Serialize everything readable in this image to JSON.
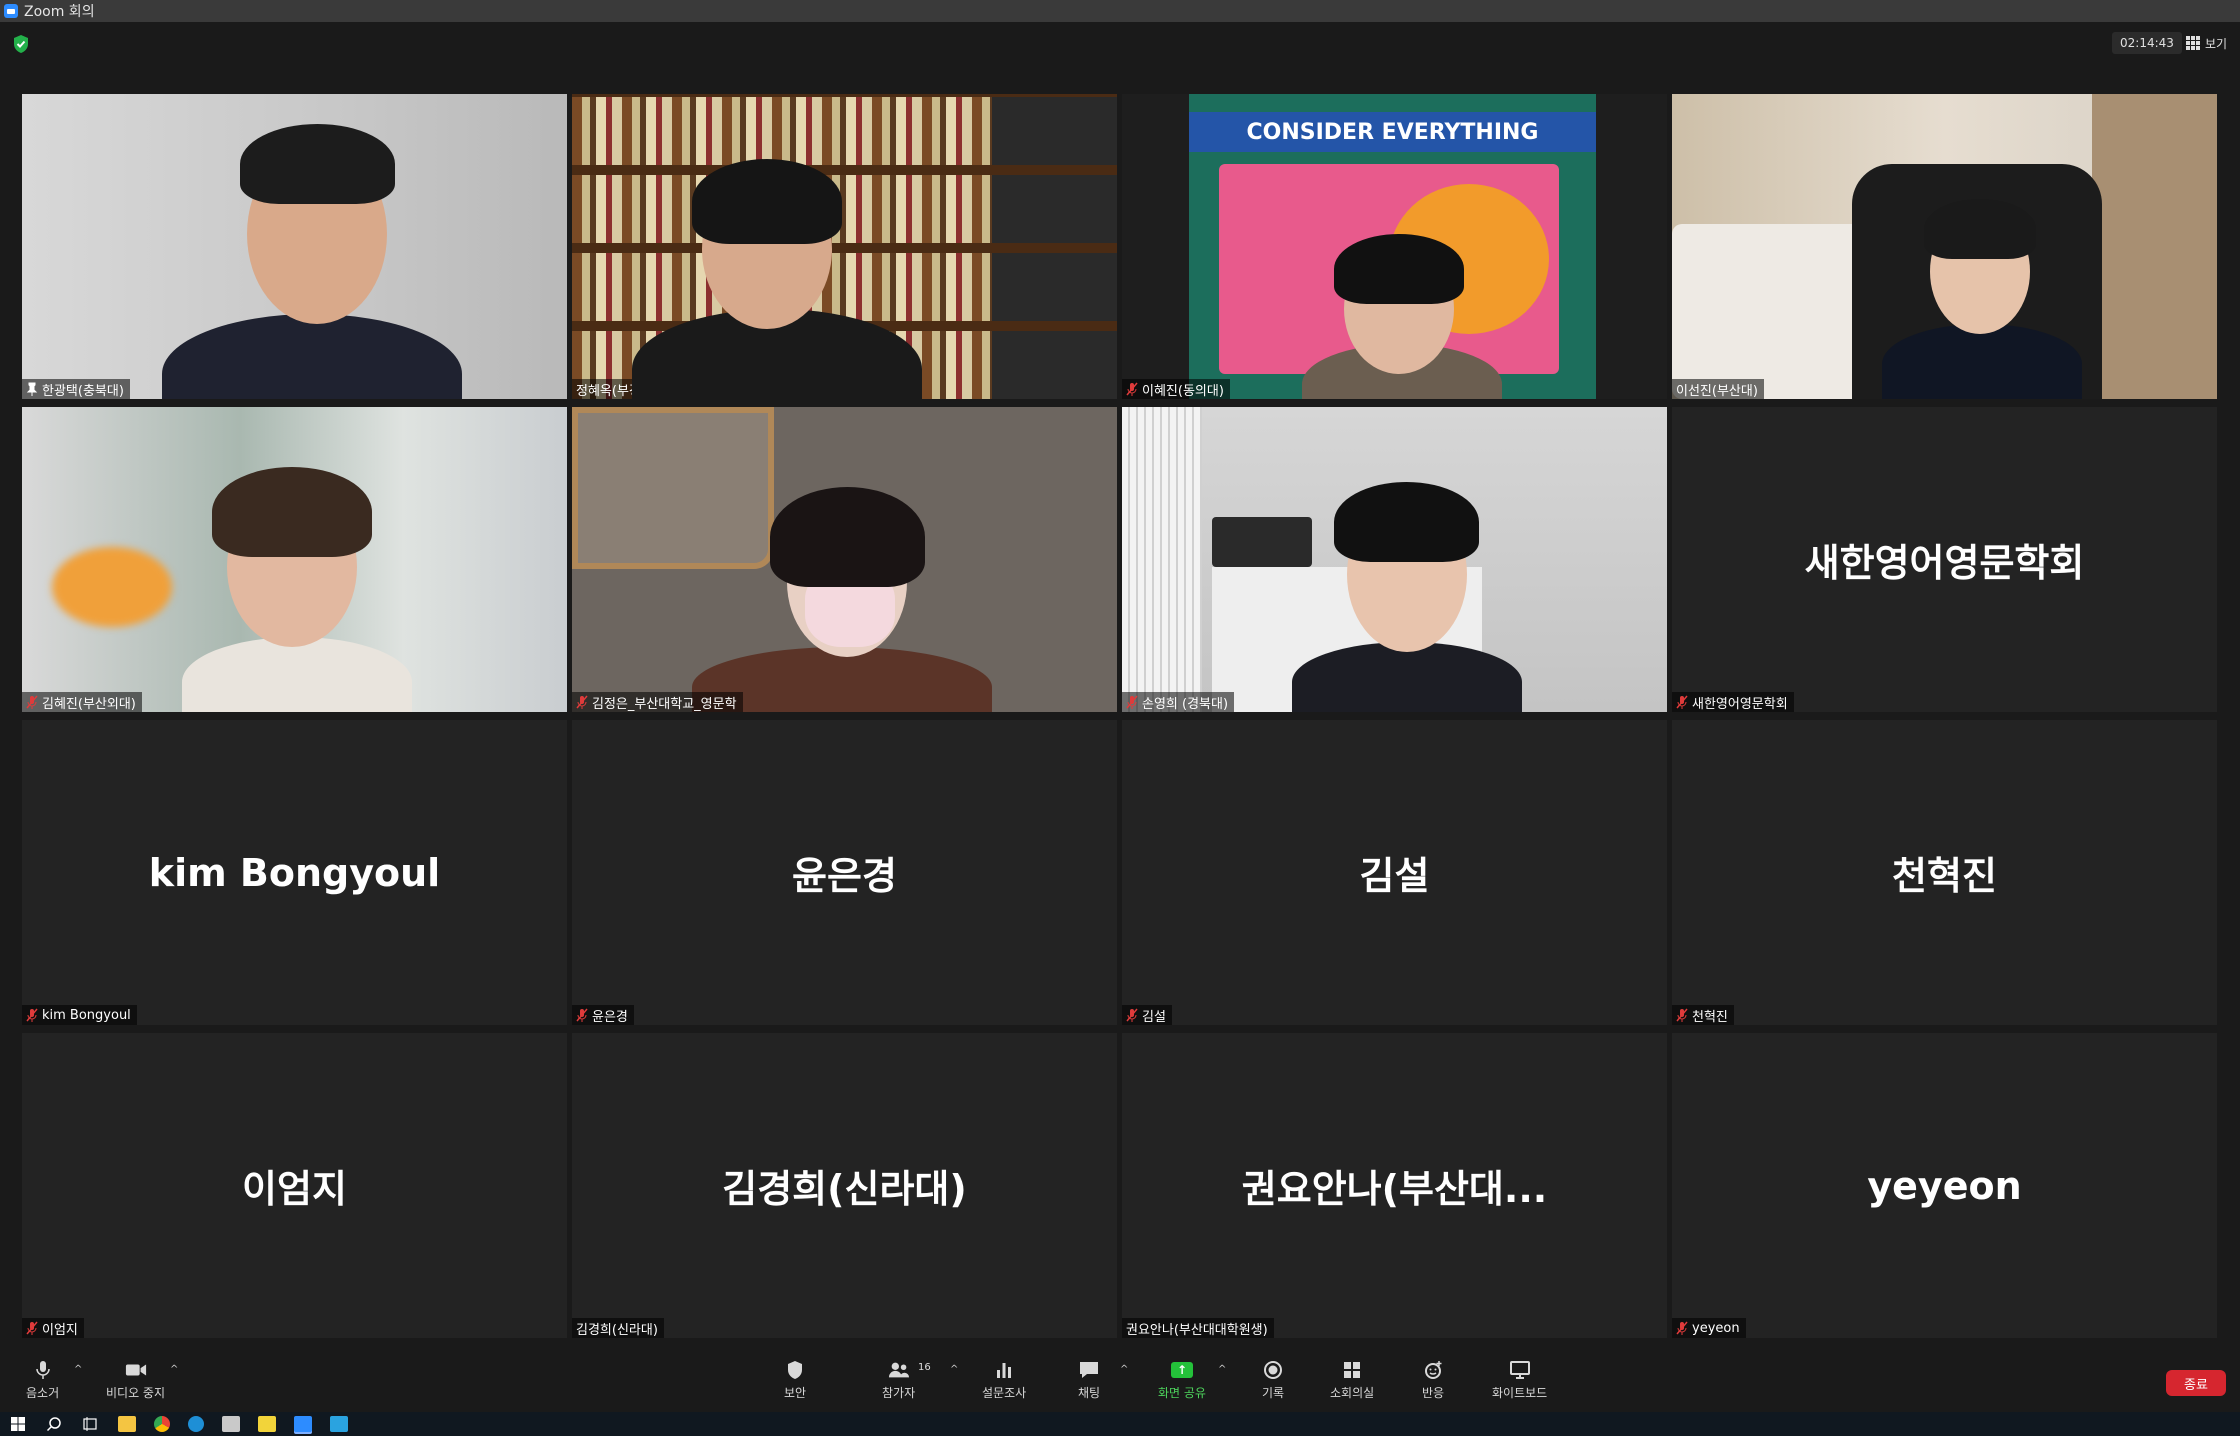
{
  "window": {
    "title": "Zoom 회의"
  },
  "topbar": {
    "timer": "02:14:43",
    "view_label": "보기"
  },
  "participants": [
    {
      "tile_label": "한광택(충북대)",
      "display_name": "",
      "video": true,
      "active_speaker": false,
      "pinned": true
    },
    {
      "tile_label": "정혜옥(부경대) JEONG, Haeook",
      "display_name": "",
      "video": true,
      "active_speaker": true,
      "muted": false
    },
    {
      "tile_label": "이혜진(동의대)",
      "display_name": "",
      "video": true,
      "active_speaker": false,
      "muted": true
    },
    {
      "tile_label": "이선진(부산대)",
      "display_name": "",
      "video": true,
      "active_speaker": false,
      "muted": false
    },
    {
      "tile_label": "김혜진(부산외대)",
      "display_name": "",
      "video": true,
      "active_speaker": false,
      "muted": true
    },
    {
      "tile_label": "김정은_부산대학교_영문학",
      "display_name": "",
      "video": true,
      "active_speaker": false,
      "muted": true
    },
    {
      "tile_label": "손영희 (경북대)",
      "display_name": "",
      "video": true,
      "active_speaker": false,
      "muted": true
    },
    {
      "tile_label": "새한영어영문학회",
      "display_name": "새한영어영문학회",
      "video": false,
      "muted": true
    },
    {
      "tile_label": "kim Bongyoul",
      "display_name": "kim Bongyoul",
      "video": false,
      "muted": true
    },
    {
      "tile_label": "윤은경",
      "display_name": "윤은경",
      "video": false,
      "muted": true
    },
    {
      "tile_label": "김설",
      "display_name": "김설",
      "video": false,
      "muted": true
    },
    {
      "tile_label": "천혁진",
      "display_name": "천혁진",
      "video": false,
      "muted": true
    },
    {
      "tile_label": "이엄지",
      "display_name": "이엄지",
      "video": false,
      "muted": true
    },
    {
      "tile_label": "김경희(신라대)",
      "display_name": "김경희(신라대)",
      "video": false,
      "muted": false
    },
    {
      "tile_label": "권요안나(부산대대학원생)",
      "display_name": "권요안나(부산대...",
      "video": false,
      "muted": false
    },
    {
      "tile_label": "yeyeon",
      "display_name": "yeyeon",
      "video": false,
      "muted": true
    }
  ],
  "tapestry_text": "CONSIDER EVERYTHING",
  "toolbar": {
    "mute_label": "음소거",
    "video_label": "비디오 중지",
    "security_label": "보안",
    "participants_label": "참가자",
    "participants_count": "16",
    "polls_label": "설문조사",
    "chat_label": "채팅",
    "share_label": "화면 공유",
    "record_label": "기록",
    "breakout_label": "소회의실",
    "reactions_label": "반응",
    "whiteboard_label": "화이트보드",
    "end_label": "종료"
  },
  "colors": {
    "active_speaker": "#c5e063",
    "end_button": "#d6262f",
    "share_green": "#24c13a",
    "mute_red": "#e03b3b"
  }
}
